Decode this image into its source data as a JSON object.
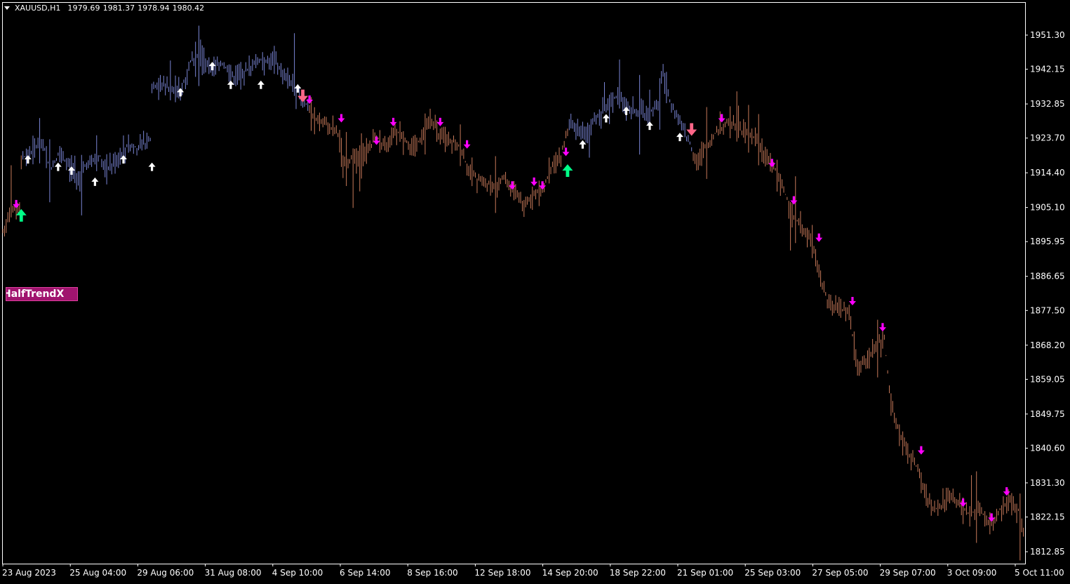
{
  "header": {
    "symbol": "XAUUSD,H1",
    "open": "1979.69",
    "high": "1981.37",
    "low": "1978.94",
    "close": "1980.42"
  },
  "indicator": {
    "name": "HalfTrendX"
  },
  "colors": {
    "background": "#000000",
    "frame": "#ffffff",
    "up_bars": "#7b86d6",
    "down_bars": "#c97a5a",
    "up_arrow": "#ffffff",
    "down_arrow": "#ff00ff",
    "signal_up": "#00ff88",
    "signal_down": "#ff6688"
  },
  "chart_data": {
    "type": "bar",
    "ylim": [
      1807.4,
      1960.0
    ],
    "ytick_labels": [
      "1951.30",
      "1942.15",
      "1932.85",
      "1923.70",
      "1914.40",
      "1905.10",
      "1895.95",
      "1886.65",
      "1877.50",
      "1868.20",
      "1859.05",
      "1849.75",
      "1840.60",
      "1831.30",
      "1822.15",
      "1812.85"
    ],
    "ytick_values": [
      1951.3,
      1942.15,
      1932.85,
      1923.7,
      1914.4,
      1905.1,
      1895.95,
      1886.65,
      1877.5,
      1868.2,
      1859.05,
      1849.75,
      1840.6,
      1831.3,
      1822.15,
      1812.85
    ],
    "xtick_labels": [
      "23 Aug 2023",
      "25 Aug 04:00",
      "29 Aug 06:00",
      "31 Aug 08:00",
      "4 Sep 10:00",
      "6 Sep 14:00",
      "8 Sep 16:00",
      "12 Sep 18:00",
      "14 Sep 20:00",
      "18 Sep 22:00",
      "21 Sep 01:00",
      "25 Sep 03:00",
      "27 Sep 05:00",
      "29 Sep 07:00",
      "3 Oct 09:00",
      "5 Oct 11:00"
    ],
    "price_path": [
      [
        0,
        1899
      ],
      [
        0.6,
        1905
      ],
      [
        1.0,
        1904
      ],
      [
        1.1,
        1918
      ],
      [
        1.7,
        1920
      ],
      [
        2.4,
        1923
      ],
      [
        2.8,
        1915
      ],
      [
        3.3,
        1919
      ],
      [
        3.8,
        1917
      ],
      [
        4.6,
        1913
      ],
      [
        5.0,
        1917
      ],
      [
        5.8,
        1919
      ],
      [
        6.2,
        1915
      ],
      [
        7.0,
        1919
      ],
      [
        7.5,
        1922
      ],
      [
        8.0,
        1921
      ],
      [
        8.8,
        1923
      ],
      [
        8.9,
        1937
      ],
      [
        9.5,
        1938
      ],
      [
        10.6,
        1936
      ],
      [
        11.2,
        1944
      ],
      [
        11.8,
        1946
      ],
      [
        12.5,
        1942
      ],
      [
        13.0,
        1944
      ],
      [
        13.8,
        1940
      ],
      [
        14.6,
        1942
      ],
      [
        15.4,
        1945
      ],
      [
        16.2,
        1944
      ],
      [
        17.0,
        1940
      ],
      [
        17.5,
        1937
      ],
      [
        17.9,
        1934
      ],
      [
        18.2,
        1932
      ],
      [
        18.5,
        1929
      ],
      [
        19.4,
        1927
      ],
      [
        20.0,
        1925
      ],
      [
        20.3,
        1917
      ],
      [
        20.8,
        1918
      ],
      [
        21.5,
        1919
      ],
      [
        22.3,
        1924
      ],
      [
        22.8,
        1921
      ],
      [
        23.3,
        1926
      ],
      [
        23.8,
        1925
      ],
      [
        24.4,
        1920
      ],
      [
        25.0,
        1924
      ],
      [
        25.5,
        1929
      ],
      [
        26.0,
        1925
      ],
      [
        26.5,
        1924
      ],
      [
        27.2,
        1922
      ],
      [
        27.8,
        1915
      ],
      [
        28.5,
        1912
      ],
      [
        29.2,
        1911
      ],
      [
        29.9,
        1913
      ],
      [
        30.4,
        1910
      ],
      [
        31.0,
        1906
      ],
      [
        31.6,
        1908
      ],
      [
        32.3,
        1911
      ],
      [
        32.8,
        1916
      ],
      [
        33.3,
        1919
      ],
      [
        33.8,
        1928
      ],
      [
        34.3,
        1925
      ],
      [
        34.9,
        1925
      ],
      [
        35.4,
        1929
      ],
      [
        36.0,
        1932
      ],
      [
        36.6,
        1935
      ],
      [
        37.2,
        1932
      ],
      [
        37.8,
        1931
      ],
      [
        38.5,
        1930
      ],
      [
        39.1,
        1933
      ],
      [
        39.4,
        1942
      ],
      [
        39.7,
        1935
      ],
      [
        40.2,
        1930
      ],
      [
        40.6,
        1926
      ],
      [
        41.0,
        1922
      ],
      [
        41.4,
        1917
      ],
      [
        42.0,
        1922
      ],
      [
        42.7,
        1926
      ],
      [
        43.3,
        1928
      ],
      [
        43.9,
        1926
      ],
      [
        44.5,
        1925
      ],
      [
        45.0,
        1923
      ],
      [
        45.4,
        1919
      ],
      [
        46.0,
        1916
      ],
      [
        46.6,
        1910
      ],
      [
        47.1,
        1903
      ],
      [
        47.7,
        1900
      ],
      [
        48.3,
        1895
      ],
      [
        48.9,
        1884
      ],
      [
        49.3,
        1879
      ],
      [
        50.0,
        1878
      ],
      [
        50.5,
        1877
      ],
      [
        51.0,
        1862
      ],
      [
        51.5,
        1864
      ],
      [
        52.1,
        1868
      ],
      [
        52.6,
        1870
      ],
      [
        53.0,
        1852
      ],
      [
        53.4,
        1846
      ],
      [
        53.9,
        1840
      ],
      [
        54.5,
        1836
      ],
      [
        55.0,
        1829
      ],
      [
        55.5,
        1824
      ],
      [
        56.0,
        1825
      ],
      [
        56.5,
        1829
      ],
      [
        57.0,
        1826
      ],
      [
        57.6,
        1823
      ],
      [
        58.3,
        1824
      ],
      [
        58.9,
        1820
      ],
      [
        59.5,
        1824
      ],
      [
        60.1,
        1826
      ],
      [
        60.6,
        1824
      ],
      [
        61.0,
        1817
      ]
    ],
    "regime_switch": [
      [
        0,
        "down"
      ],
      [
        1.1,
        "up"
      ],
      [
        18.2,
        "down"
      ],
      [
        33.8,
        "up"
      ],
      [
        41.2,
        "down"
      ]
    ],
    "arrows": [
      {
        "t": 0.8,
        "p": 1906,
        "dir": "down",
        "big": false
      },
      {
        "t": 1.1,
        "p": 1903,
        "dir": "up",
        "big": true
      },
      {
        "t": 1.5,
        "p": 1918,
        "dir": "up",
        "big": false
      },
      {
        "t": 3.3,
        "p": 1916,
        "dir": "up",
        "big": false
      },
      {
        "t": 4.1,
        "p": 1915,
        "dir": "up",
        "big": false
      },
      {
        "t": 5.5,
        "p": 1912,
        "dir": "up",
        "big": false
      },
      {
        "t": 7.2,
        "p": 1918,
        "dir": "up",
        "big": false
      },
      {
        "t": 8.9,
        "p": 1916,
        "dir": "up",
        "big": false
      },
      {
        "t": 10.6,
        "p": 1936,
        "dir": "up",
        "big": false
      },
      {
        "t": 12.5,
        "p": 1943,
        "dir": "up",
        "big": false
      },
      {
        "t": 13.6,
        "p": 1938,
        "dir": "up",
        "big": false
      },
      {
        "t": 15.4,
        "p": 1938,
        "dir": "up",
        "big": false
      },
      {
        "t": 17.6,
        "p": 1937,
        "dir": "up",
        "big": false
      },
      {
        "t": 17.9,
        "p": 1935,
        "dir": "down",
        "big": true
      },
      {
        "t": 18.3,
        "p": 1934,
        "dir": "down",
        "big": false
      },
      {
        "t": 20.2,
        "p": 1929,
        "dir": "down",
        "big": false
      },
      {
        "t": 22.3,
        "p": 1923,
        "dir": "down",
        "big": false
      },
      {
        "t": 23.3,
        "p": 1928,
        "dir": "down",
        "big": false
      },
      {
        "t": 26.1,
        "p": 1928,
        "dir": "down",
        "big": false
      },
      {
        "t": 27.7,
        "p": 1922,
        "dir": "down",
        "big": false
      },
      {
        "t": 30.4,
        "p": 1911,
        "dir": "down",
        "big": false
      },
      {
        "t": 31.7,
        "p": 1912,
        "dir": "down",
        "big": false
      },
      {
        "t": 32.2,
        "p": 1911,
        "dir": "down",
        "big": false
      },
      {
        "t": 33.6,
        "p": 1920,
        "dir": "down",
        "big": false
      },
      {
        "t": 33.7,
        "p": 1915,
        "dir": "up",
        "big": true
      },
      {
        "t": 34.6,
        "p": 1922,
        "dir": "up",
        "big": false
      },
      {
        "t": 36.0,
        "p": 1929,
        "dir": "up",
        "big": false
      },
      {
        "t": 37.2,
        "p": 1931,
        "dir": "up",
        "big": false
      },
      {
        "t": 38.6,
        "p": 1927,
        "dir": "up",
        "big": false
      },
      {
        "t": 40.4,
        "p": 1924,
        "dir": "up",
        "big": false
      },
      {
        "t": 41.1,
        "p": 1926,
        "dir": "down",
        "big": true
      },
      {
        "t": 42.9,
        "p": 1929,
        "dir": "down",
        "big": false
      },
      {
        "t": 45.9,
        "p": 1917,
        "dir": "down",
        "big": false
      },
      {
        "t": 47.2,
        "p": 1907,
        "dir": "down",
        "big": false
      },
      {
        "t": 48.7,
        "p": 1897,
        "dir": "down",
        "big": false
      },
      {
        "t": 50.7,
        "p": 1880,
        "dir": "down",
        "big": false
      },
      {
        "t": 52.5,
        "p": 1873,
        "dir": "down",
        "big": false
      },
      {
        "t": 54.8,
        "p": 1840,
        "dir": "down",
        "big": false
      },
      {
        "t": 57.3,
        "p": 1826,
        "dir": "down",
        "big": false
      },
      {
        "t": 59.0,
        "p": 1822,
        "dir": "down",
        "big": false
      },
      {
        "t": 59.9,
        "p": 1829,
        "dir": "down",
        "big": false
      }
    ]
  }
}
